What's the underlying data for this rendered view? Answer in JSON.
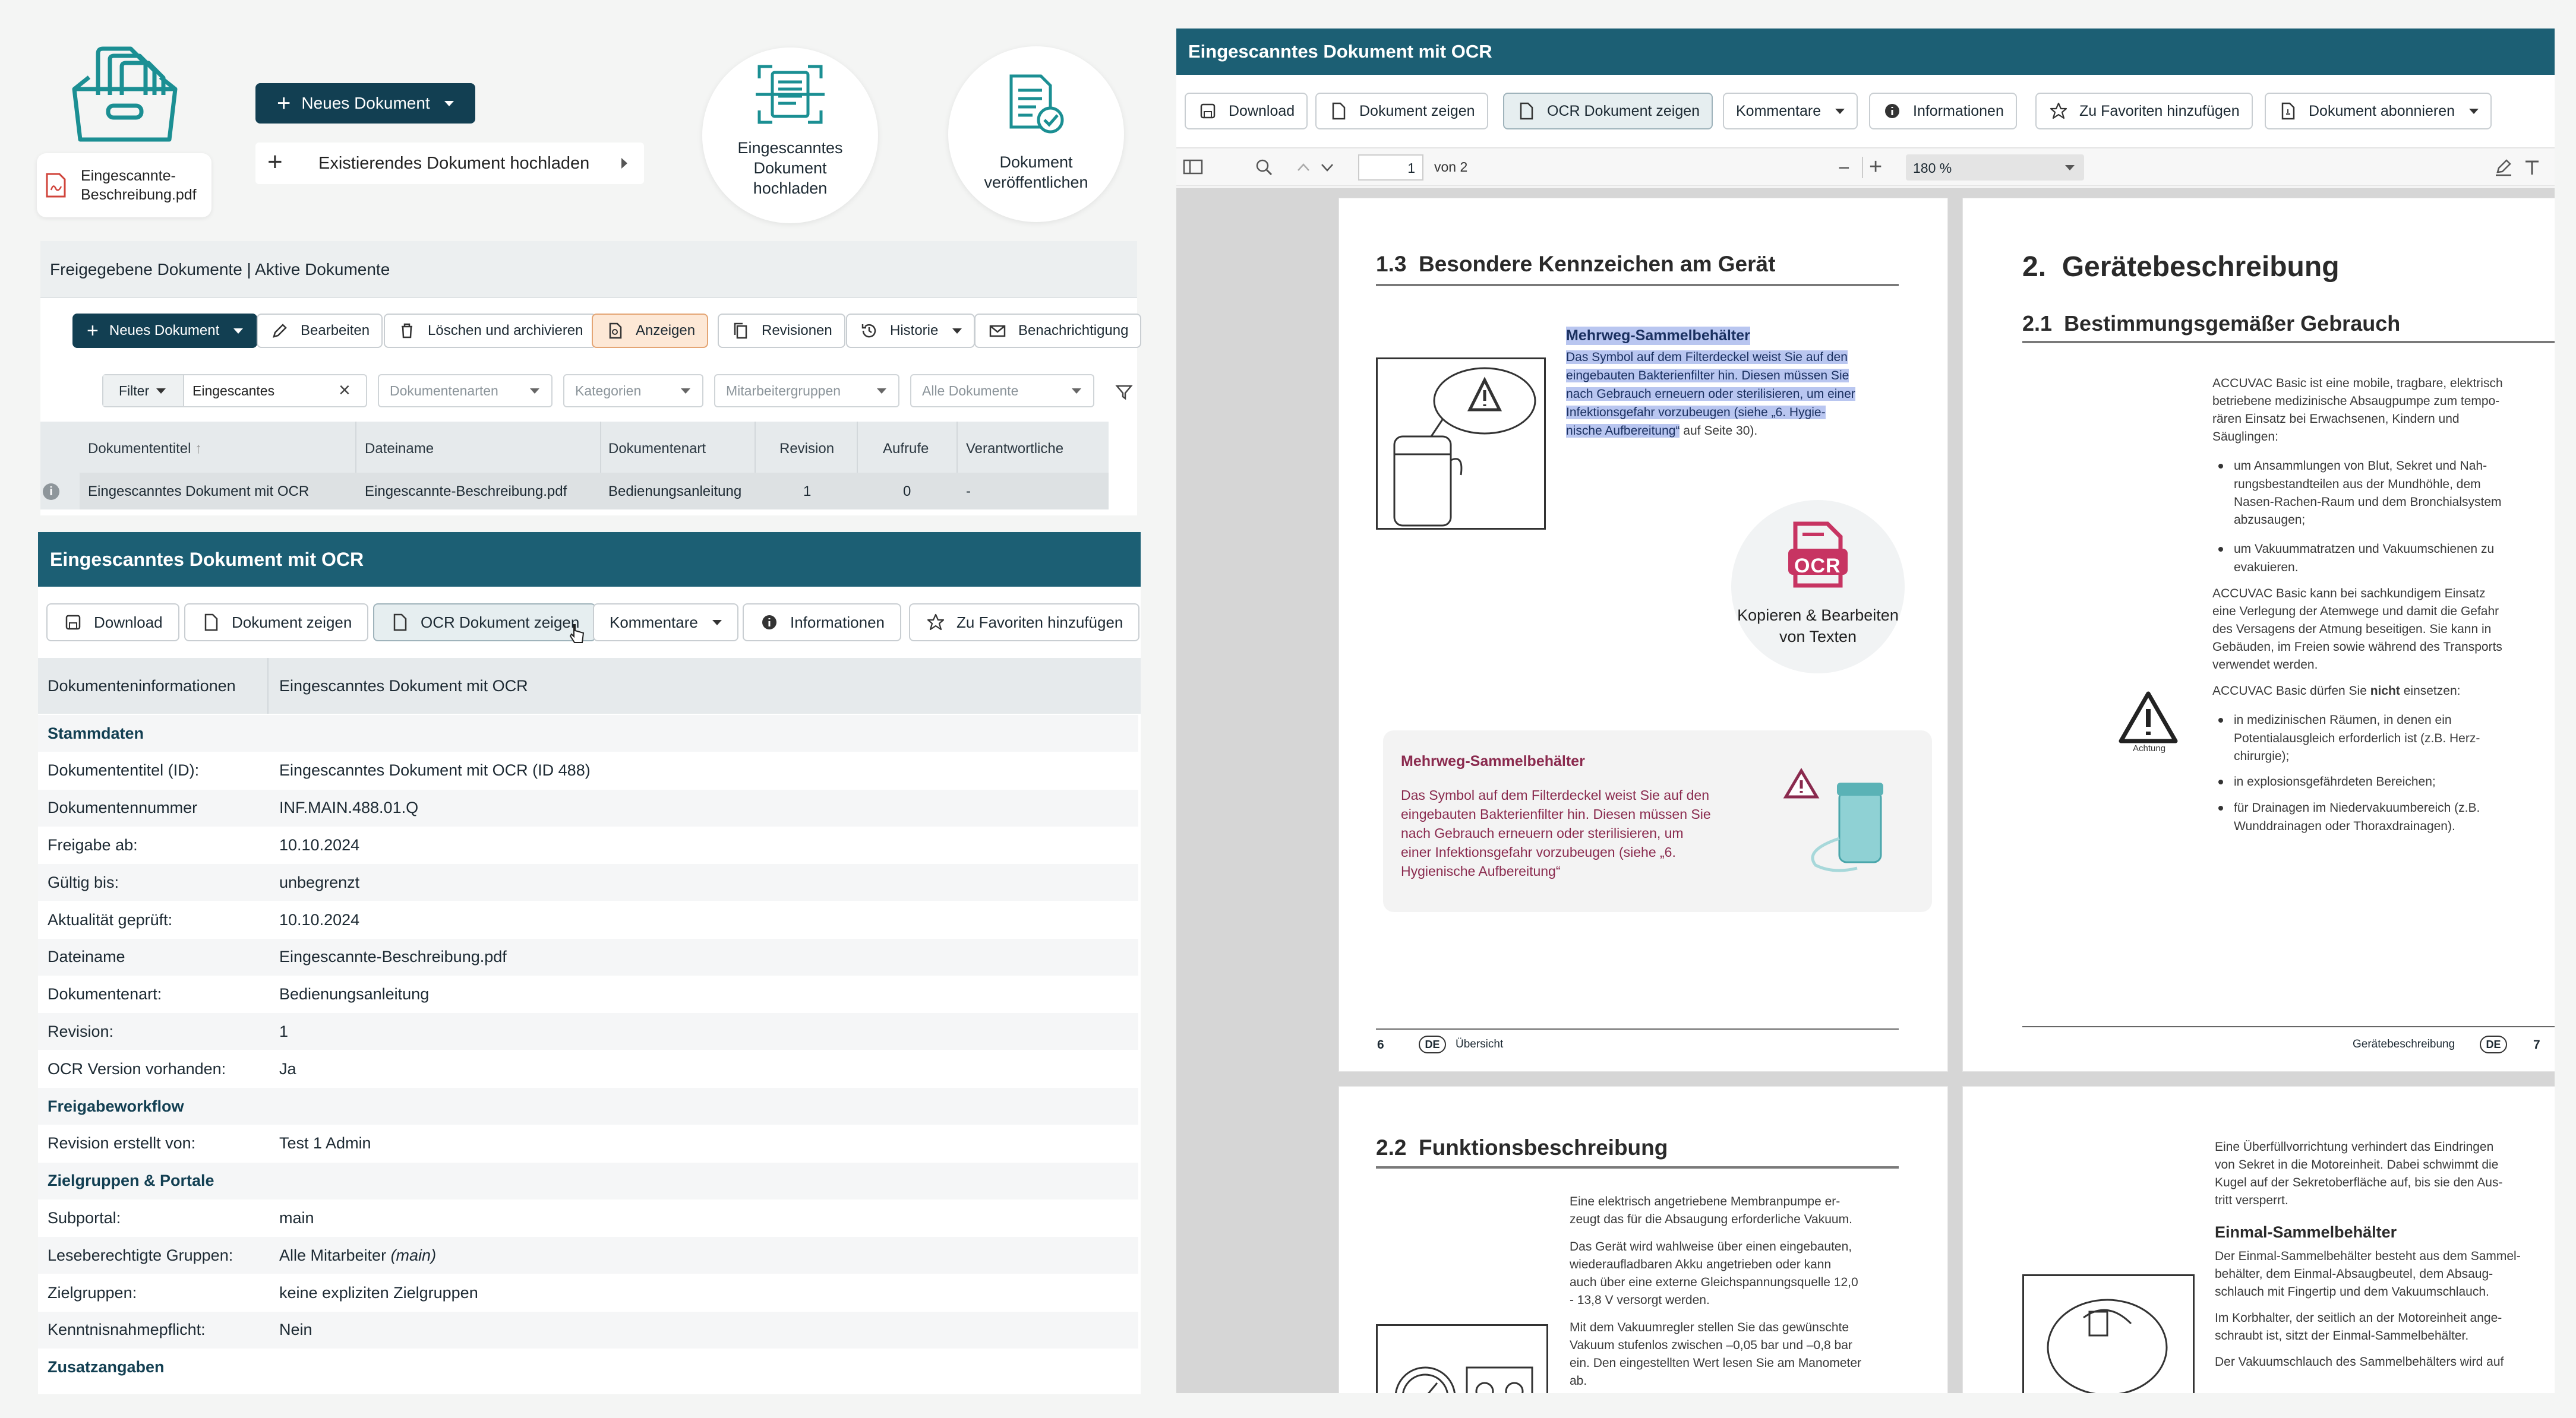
{
  "left": {
    "file_card_label": "Eingescannte-Beschreibung.pdf",
    "new_doc_button": "Neues Dokument",
    "upload_existing": "Existierendes Dokument hochladen",
    "circle_scan_label": "Eingescanntes Dokument hochladen",
    "circle_publish_label": "Dokument veröffentlichen",
    "breadcrumb": "Freigegebene Dokumente | Aktive Dokumente",
    "toolbar": {
      "new": "Neues Dokument",
      "edit": "Bearbeiten",
      "delete": "Löschen und archivieren",
      "show": "Anzeigen",
      "revisions": "Revisionen",
      "history": "Historie",
      "notify": "Benachrichtigung"
    },
    "filter": {
      "label": "Filter",
      "value": "Eingescantes",
      "doc_types": "Dokumentenarten",
      "categories": "Kategorien",
      "employee_groups": "Mitarbeitergruppen",
      "all_docs": "Alle Dokumente"
    },
    "table": {
      "headers": [
        "Dokumententitel",
        "Dateiname",
        "Dokumentenart",
        "Revision",
        "Aufrufe",
        "Verantwortliche"
      ],
      "row": [
        "Eingescanntes Dokument mit OCR",
        "Eingescannte-Beschreibung.pdf",
        "Bedienungsanleitung",
        "1",
        "0",
        "-"
      ]
    },
    "detail": {
      "title": "Eingescanntes Dokument mit OCR",
      "buttons": {
        "download": "Download",
        "show": "Dokument zeigen",
        "ocr": "OCR Dokument zeigen",
        "comments": "Kommentare",
        "info": "Informationen",
        "favorites": "Zu Favoriten hinzufügen"
      },
      "tab_label": "Dokumenteninformationen",
      "tab_value": "Eingescanntes Dokument mit OCR",
      "rows": [
        {
          "k": "Stammdaten",
          "v": "",
          "section": true
        },
        {
          "k": "Dokumententitel (ID):",
          "v": "Eingescanntes Dokument mit OCR (ID 488)"
        },
        {
          "k": "Dokumentennummer",
          "v": "INF.MAIN.488.01.Q"
        },
        {
          "k": "Freigabe ab:",
          "v": "10.10.2024"
        },
        {
          "k": "Gültig bis:",
          "v": "unbegrenzt"
        },
        {
          "k": "Aktualität geprüft:",
          "v": "10.10.2024"
        },
        {
          "k": "Dateiname",
          "v": "Eingescannte-Beschreibung.pdf"
        },
        {
          "k": "Dokumentenart:",
          "v": "Bedienungsanleitung"
        },
        {
          "k": "Revision:",
          "v": "1"
        },
        {
          "k": "OCR Version vorhanden:",
          "v": "Ja"
        },
        {
          "k": "Freigabeworkflow",
          "v": "",
          "section": true
        },
        {
          "k": "Revision erstellt von:",
          "v": "Test 1 Admin"
        },
        {
          "k": "Zielgruppen & Portale",
          "v": "",
          "section": true
        },
        {
          "k": "Subportal:",
          "v": "main"
        },
        {
          "k": "Leseberechtigte Gruppen:",
          "v": "Alle Mitarbeiter",
          "v_em": "(main)"
        },
        {
          "k": "Zielgruppen:",
          "v": "keine expliziten Zielgruppen"
        },
        {
          "k": "Kenntnisnahmepflicht:",
          "v": "Nein"
        },
        {
          "k": "Zusatzangaben",
          "v": "",
          "section": true
        }
      ]
    }
  },
  "right": {
    "title": "Eingescanntes Dokument mit OCR",
    "buttons": {
      "download": "Download",
      "show": "Dokument zeigen",
      "ocr": "OCR Dokument zeigen",
      "comments": "Kommentare",
      "info": "Informationen",
      "favorites": "Zu Favoriten hinzufügen",
      "subscribe": "Dokument abonnieren"
    },
    "viewer": {
      "page_value": "1",
      "page_of": "von 2",
      "zoom": "180 %"
    },
    "page6": {
      "heading_num": "1.3",
      "heading": "Besondere Kennzeichen am Gerät",
      "sub": "Mehrweg-Sammelbehälter",
      "lines": [
        "Das Symbol auf dem Filterdeckel weist Sie auf den",
        "eingebauten Bakterienfilter hin. Diesen müssen Sie",
        "nach Gebrauch erneuern oder sterilisieren, um einer",
        "Infektionsgefahr vorzubeugen (siehe „6. Hygie-",
        "nische Aufbereitung“"
      ],
      "lines_tail": " auf Seite 30).",
      "ocr_label": "OCR",
      "ocr_caption": "Kopieren & Bearbeiten von Texten",
      "card_title": "Mehrweg-Sammelbehälter",
      "card_lines": [
        "Das Symbol auf dem Filterdeckel weist Sie auf den",
        "eingebauten Bakterienfilter hin. Diesen müssen Sie",
        "nach Gebrauch erneuern oder sterilisieren, um",
        "einer Infektionsgefahr vorzubeugen (siehe „6.",
        "Hygienische Aufbereitung“"
      ],
      "footer_num": "6",
      "footer_lang": "DE",
      "footer_text": "Übersicht"
    },
    "page7": {
      "heading_num": "2.",
      "heading": "Gerätebeschreibung",
      "sub_num": "2.1",
      "sub": "Bestimmungsgemäßer Gebrauch",
      "p1": [
        "ACCUVAC Basic ist eine mobile, tragbare, elektrisch",
        "betriebene medizinische Absaugpumpe zum tempo-",
        "rären Einsatz bei Erwachsenen, Kindern und",
        "Säuglingen:"
      ],
      "b1": [
        "um Ansammlungen von Blut, Sekret und Nah-",
        "rungsbestandteilen aus der Mundhöhle, dem",
        "Nasen-Rachen-Raum und dem Bronchialsystem",
        "abzusaugen;"
      ],
      "b2": [
        "um Vakuummatratzen und Vakuumschienen zu",
        "evakuieren."
      ],
      "p2": [
        "ACCUVAC Basic kann bei sachkundigem Einsatz",
        "eine Verlegung der Atemwege und damit die Gefahr",
        "des Versagens der Atmung beseitigen. Sie kann in",
        "Gebäuden, im Freien sowie während des Transports",
        "verwendet werden."
      ],
      "p3_pre": "ACCUVAC Basic dürfen Sie ",
      "p3_bold": "nicht",
      "p3_post": " einsetzen:",
      "warn_label": "Achtung",
      "b3": [
        "in medizinischen Räumen, in denen ein",
        "Potentialausgleich erforderlich ist (z.B. Herz-",
        "chirurgie);"
      ],
      "b4": [
        "in explosionsgefährdeten Bereichen;"
      ],
      "b5": [
        "für Drainagen im Niedervakuumbereich (z.B.",
        "Wunddrainagen oder Thoraxdrainagen)."
      ],
      "footer_text": "Gerätebeschreibung",
      "footer_lang": "DE",
      "footer_num": "7"
    },
    "page8": {
      "heading_num": "2.2",
      "heading": "Funktionsbeschreibung",
      "p1": [
        "Eine elektrisch angetriebene Membranpumpe er-",
        "zeugt das für die Absaugung erforderliche Vakuum."
      ],
      "p2": [
        "Das Gerät wird wahlweise über einen eingebauten,",
        "wiederaufladbaren Akku angetrieben oder kann",
        "auch über eine externe Gleichspannungsquelle 12,0",
        "- 13,8 V versorgt werden."
      ],
      "p3": [
        "Mit dem Vakuumregler stellen Sie das gewünschte",
        "Vakuum stufenlos zwischen –0,05 bar und –0,8 bar",
        "ein. Den eingestellten Wert lesen Sie am Manometer",
        "ab."
      ]
    },
    "page9": {
      "p1": [
        "Eine Überfüllvorrichtung verhindert das Eindringen",
        "von Sekret in die Motoreinheit. Dabei schwimmt die",
        "Kugel auf der Sekretoberfläche auf, bis sie den Aus-",
        "tritt versperrt."
      ],
      "sub": "Einmal-Sammelbehälter",
      "p2": [
        "Der Einmal-Sammelbehälter besteht aus dem Sammel-",
        "behälter, dem Einmal-Absaugbeutel, dem Absaug-",
        "schlauch mit Fingertip und dem Vakuumschlauch."
      ],
      "p3": [
        "Im Korbhalter, der seitlich an der Motoreinheit ange-",
        "schraubt ist, sitzt der Einmal-Sammelbehälter."
      ],
      "p4": [
        "Der Vakuumschlauch des Sammelbehälters wird auf"
      ]
    }
  }
}
